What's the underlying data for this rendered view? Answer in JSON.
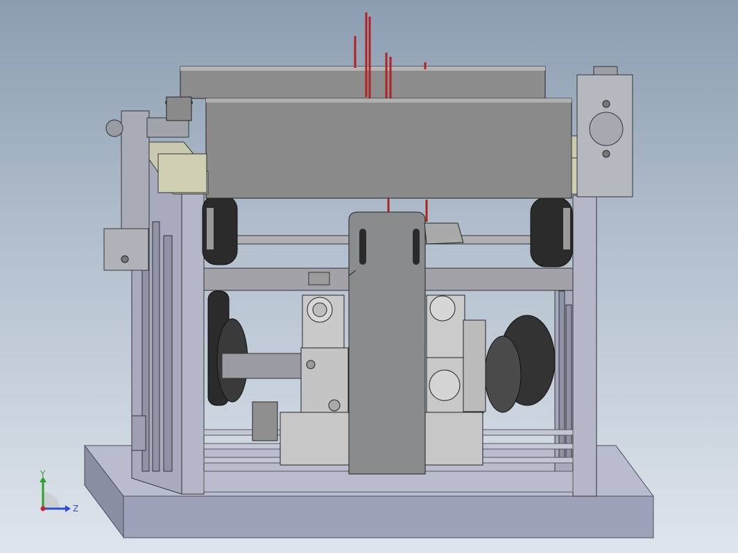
{
  "viewport": {
    "background_top": "#8c9db0",
    "background_bottom": "#dfe5ec"
  },
  "model": {
    "base_color": "#9ea2b8",
    "frame_color": "#a7abbd",
    "housing_color": "#8c8c8c",
    "bracket_color": "#8a8b8c",
    "block_color": "#c9c9b0",
    "roller_color": "#2b2b2b",
    "rod_color": "#b22222"
  },
  "triad": {
    "y_label": "Y",
    "z_label": "Z",
    "y_color": "#2e9e2e",
    "z_color": "#2f4fd0",
    "x_color": "#c62828"
  }
}
